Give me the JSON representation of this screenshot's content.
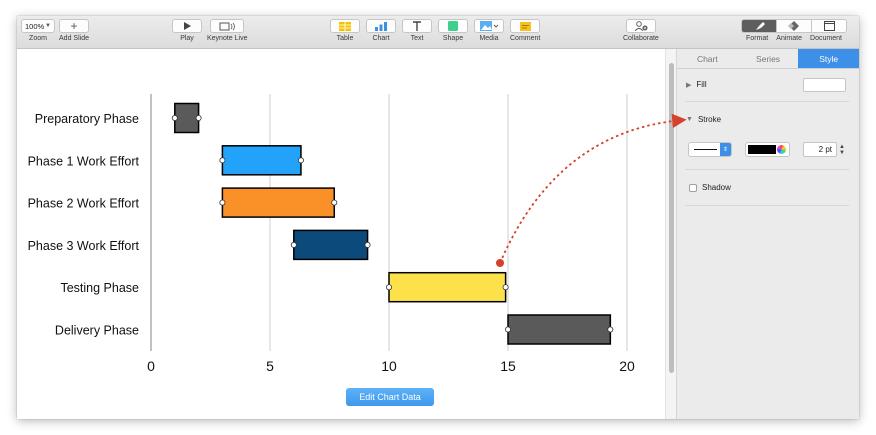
{
  "toolbar": {
    "zoom": {
      "value": "100%",
      "label": "Zoom"
    },
    "add_slide": {
      "label": "Add Slide"
    },
    "play": {
      "label": "Play"
    },
    "keynote_live": {
      "label": "Keynote Live"
    },
    "table": {
      "label": "Table"
    },
    "chart": {
      "label": "Chart"
    },
    "text": {
      "label": "Text"
    },
    "shape": {
      "label": "Shape"
    },
    "media": {
      "label": "Media"
    },
    "comment": {
      "label": "Comment"
    },
    "collaborate": {
      "label": "Collaborate"
    },
    "format": {
      "label": "Format"
    },
    "animate": {
      "label": "Animate"
    },
    "document": {
      "label": "Document"
    }
  },
  "inspector": {
    "tabs": [
      {
        "label": "Chart",
        "active": false
      },
      {
        "label": "Series",
        "active": false
      },
      {
        "label": "Style",
        "active": true
      }
    ],
    "fill_label": "Fill",
    "stroke_label": "Stroke",
    "stroke_width": "2 pt",
    "stroke_color": "#000000",
    "shadow_label": "Shadow",
    "shadow_checked": false
  },
  "edit_chart_button": "Edit Chart Data",
  "chart_data": {
    "type": "bar",
    "orientation": "horizontal",
    "categories": [
      "Preparatory Phase",
      "Phase 1 Work Effort",
      "Phase 2 Work Effort",
      "Phase 3 Work Effort",
      "Testing Phase",
      "Delivery Phase"
    ],
    "starts": [
      1,
      3,
      3,
      6,
      10,
      15
    ],
    "ends": [
      2,
      6.3,
      7.7,
      9.1,
      14.9,
      19.3
    ],
    "colors": [
      "#5a5a5a",
      "#22a2f8",
      "#f99028",
      "#0b4a7a",
      "#fde14a",
      "#5a5a5a"
    ],
    "xlim": [
      0,
      20
    ],
    "xticks": [
      "0",
      "5",
      "10",
      "15",
      "20"
    ],
    "grid": true,
    "title": "",
    "xlabel": "",
    "ylabel": ""
  }
}
